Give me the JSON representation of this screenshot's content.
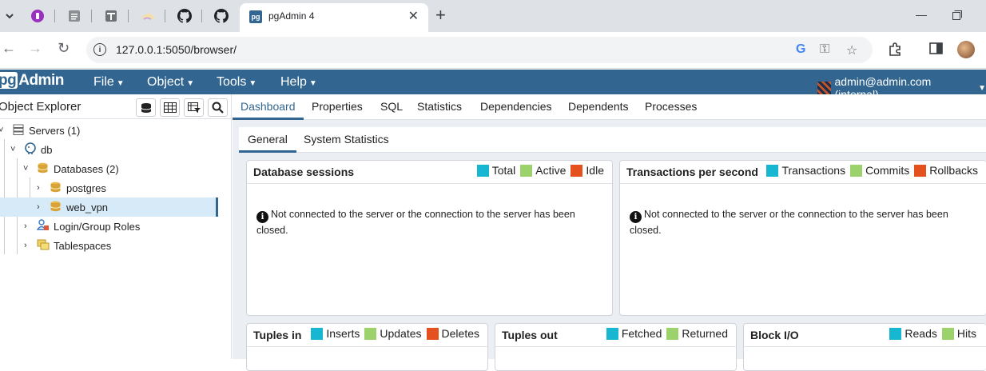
{
  "browser": {
    "active_tab": {
      "title": "pgAdmin 4",
      "favicon_text": "pg"
    },
    "url": "127.0.0.1:5050/browser/"
  },
  "app": {
    "logo": {
      "pg": "pg",
      "rest": "Admin"
    },
    "menus": [
      "File",
      "Object",
      "Tools",
      "Help"
    ],
    "user": "admin@admin.com (internal)"
  },
  "explorer": {
    "title": "Object Explorer",
    "tree": [
      {
        "label": "Servers (1)",
        "level": 0,
        "icon": "servers-icon"
      },
      {
        "label": "db",
        "level": 1,
        "icon": "postgres-elephant-icon"
      },
      {
        "label": "Databases (2)",
        "level": 2,
        "icon": "databases-icon"
      },
      {
        "label": "postgres",
        "level": 3,
        "icon": "database-icon"
      },
      {
        "label": "web_vpn",
        "level": 3,
        "icon": "database-icon",
        "selected": true
      },
      {
        "label": "Login/Group Roles",
        "level": 2,
        "icon": "roles-icon"
      },
      {
        "label": "Tablespaces",
        "level": 2,
        "icon": "tablespaces-icon"
      }
    ]
  },
  "main_tabs": [
    "Dashboard",
    "Properties",
    "SQL",
    "Statistics",
    "Dependencies",
    "Dependents",
    "Processes"
  ],
  "sub_tabs": [
    "General",
    "System Statistics"
  ],
  "colors": {
    "cyan": "#17b7d1",
    "green": "#9bd26b",
    "orange": "#e4511e",
    "header": "#326690"
  },
  "panels": {
    "sessions": {
      "title": "Database sessions",
      "legend": [
        "Total",
        "Active",
        "Idle"
      ]
    },
    "transactions": {
      "title": "Transactions per second",
      "legend": [
        "Transactions",
        "Commits",
        "Rollbacks"
      ]
    },
    "tuples_in": {
      "title": "Tuples in",
      "legend": [
        "Inserts",
        "Updates",
        "Deletes"
      ]
    },
    "tuples_out": {
      "title": "Tuples out",
      "legend": [
        "Fetched",
        "Returned"
      ]
    },
    "block_io": {
      "title": "Block I/O",
      "legend": [
        "Reads",
        "Hits"
      ]
    }
  },
  "message": "Not connected to the server or the connection to the server has been closed."
}
